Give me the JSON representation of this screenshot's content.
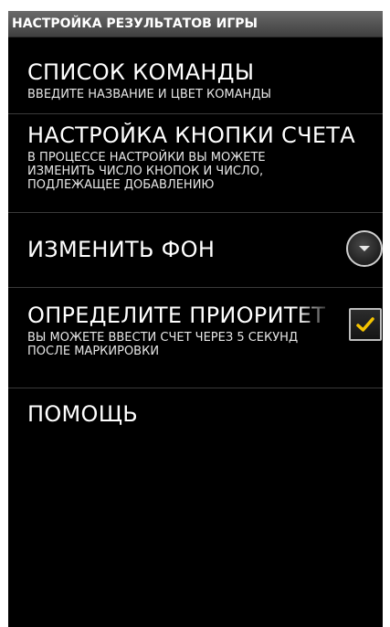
{
  "header": {
    "title": "НАСТРОЙКА РЕЗУЛЬТАТОВ ИГРЫ"
  },
  "settings": [
    {
      "title": "СПИСОК КОМАНДЫ",
      "summary": "ВВЕДИТЕ НАЗВАНИЕ И ЦВЕТ КОМАНДЫ"
    },
    {
      "title": "НАСТРОЙКА КНОПКИ СЧЕТА",
      "summary": "В ПРОЦЕССЕ НАСТРОЙКИ ВЫ МОЖЕТЕ ИЗМЕНИТЬ ЧИСЛО КНОПОК И ЧИСЛО, ПОДЛЕЖАЩЕЕ ДОБАВЛЕНИЮ"
    },
    {
      "title": "ИЗМЕНИТЬ ФОН",
      "control_icon": "chevron-down-icon"
    },
    {
      "title": "ОПРЕДЕЛИТЕ ПРИОРИТЕТ",
      "summary": "ВЫ МОЖЕТЕ ВВЕСТИ СЧЕТ ЧЕРЕЗ 5 СЕКУНД ПОСЛЕ МАРКИРОВКИ",
      "checked": true,
      "control_icon": "checkmark-icon"
    },
    {
      "title": "ПОМОЩЬ"
    }
  ],
  "colors": {
    "background": "#000000",
    "text": "#ffffff",
    "checkmark": "#f5c400",
    "divider": "#3a3a3a"
  }
}
